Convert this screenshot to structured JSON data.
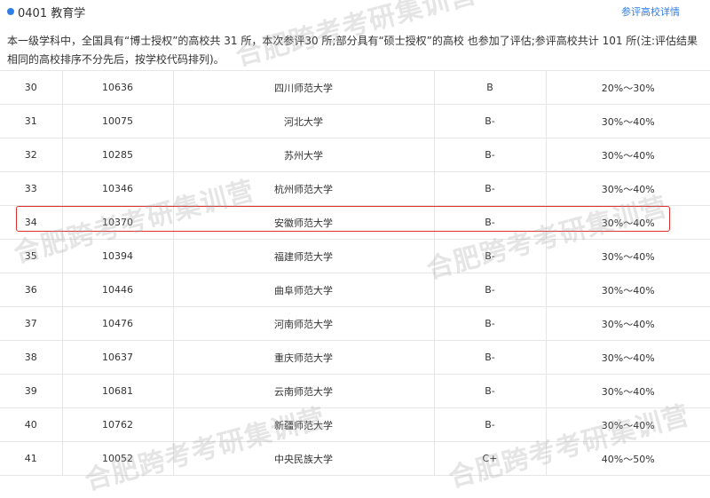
{
  "header": {
    "title": "0401 教育学",
    "detail_link": "参评高校详情",
    "accent_color": "#2f7ee8"
  },
  "description": "本一级学科中，全国具有“博士授权”的高校共 31 所，本次参评30 所;部分具有“硕士授权”的高校 也参加了评估;参评高校共计 101 所(注:评估结果相同的高校排序不分先后，按学校代码排列)。",
  "rows": [
    {
      "rank": "30",
      "code": "10636",
      "name": "四川师范大学",
      "grade": "B",
      "range": "20%～30%"
    },
    {
      "rank": "31",
      "code": "10075",
      "name": "河北大学",
      "grade": "B-",
      "range": "30%～40%"
    },
    {
      "rank": "32",
      "code": "10285",
      "name": "苏州大学",
      "grade": "B-",
      "range": "30%～40%"
    },
    {
      "rank": "33",
      "code": "10346",
      "name": "杭州师范大学",
      "grade": "B-",
      "range": "30%～40%"
    },
    {
      "rank": "34",
      "code": "10370",
      "name": "安徽师范大学",
      "grade": "B-",
      "range": "30%～40%"
    },
    {
      "rank": "35",
      "code": "10394",
      "name": "福建师范大学",
      "grade": "B-",
      "range": "30%～40%"
    },
    {
      "rank": "36",
      "code": "10446",
      "name": "曲阜师范大学",
      "grade": "B-",
      "range": "30%～40%"
    },
    {
      "rank": "37",
      "code": "10476",
      "name": "河南师范大学",
      "grade": "B-",
      "range": "30%～40%"
    },
    {
      "rank": "38",
      "code": "10637",
      "name": "重庆师范大学",
      "grade": "B-",
      "range": "30%～40%"
    },
    {
      "rank": "39",
      "code": "10681",
      "name": "云南师范大学",
      "grade": "B-",
      "range": "30%～40%"
    },
    {
      "rank": "40",
      "code": "10762",
      "name": "新疆师范大学",
      "grade": "B-",
      "range": "30%～40%"
    },
    {
      "rank": "41",
      "code": "10052",
      "name": "中央民族大学",
      "grade": "C+",
      "range": "40%～50%"
    }
  ],
  "highlight_color": "#e0302b",
  "watermark": "合肥跨考考研集训营"
}
